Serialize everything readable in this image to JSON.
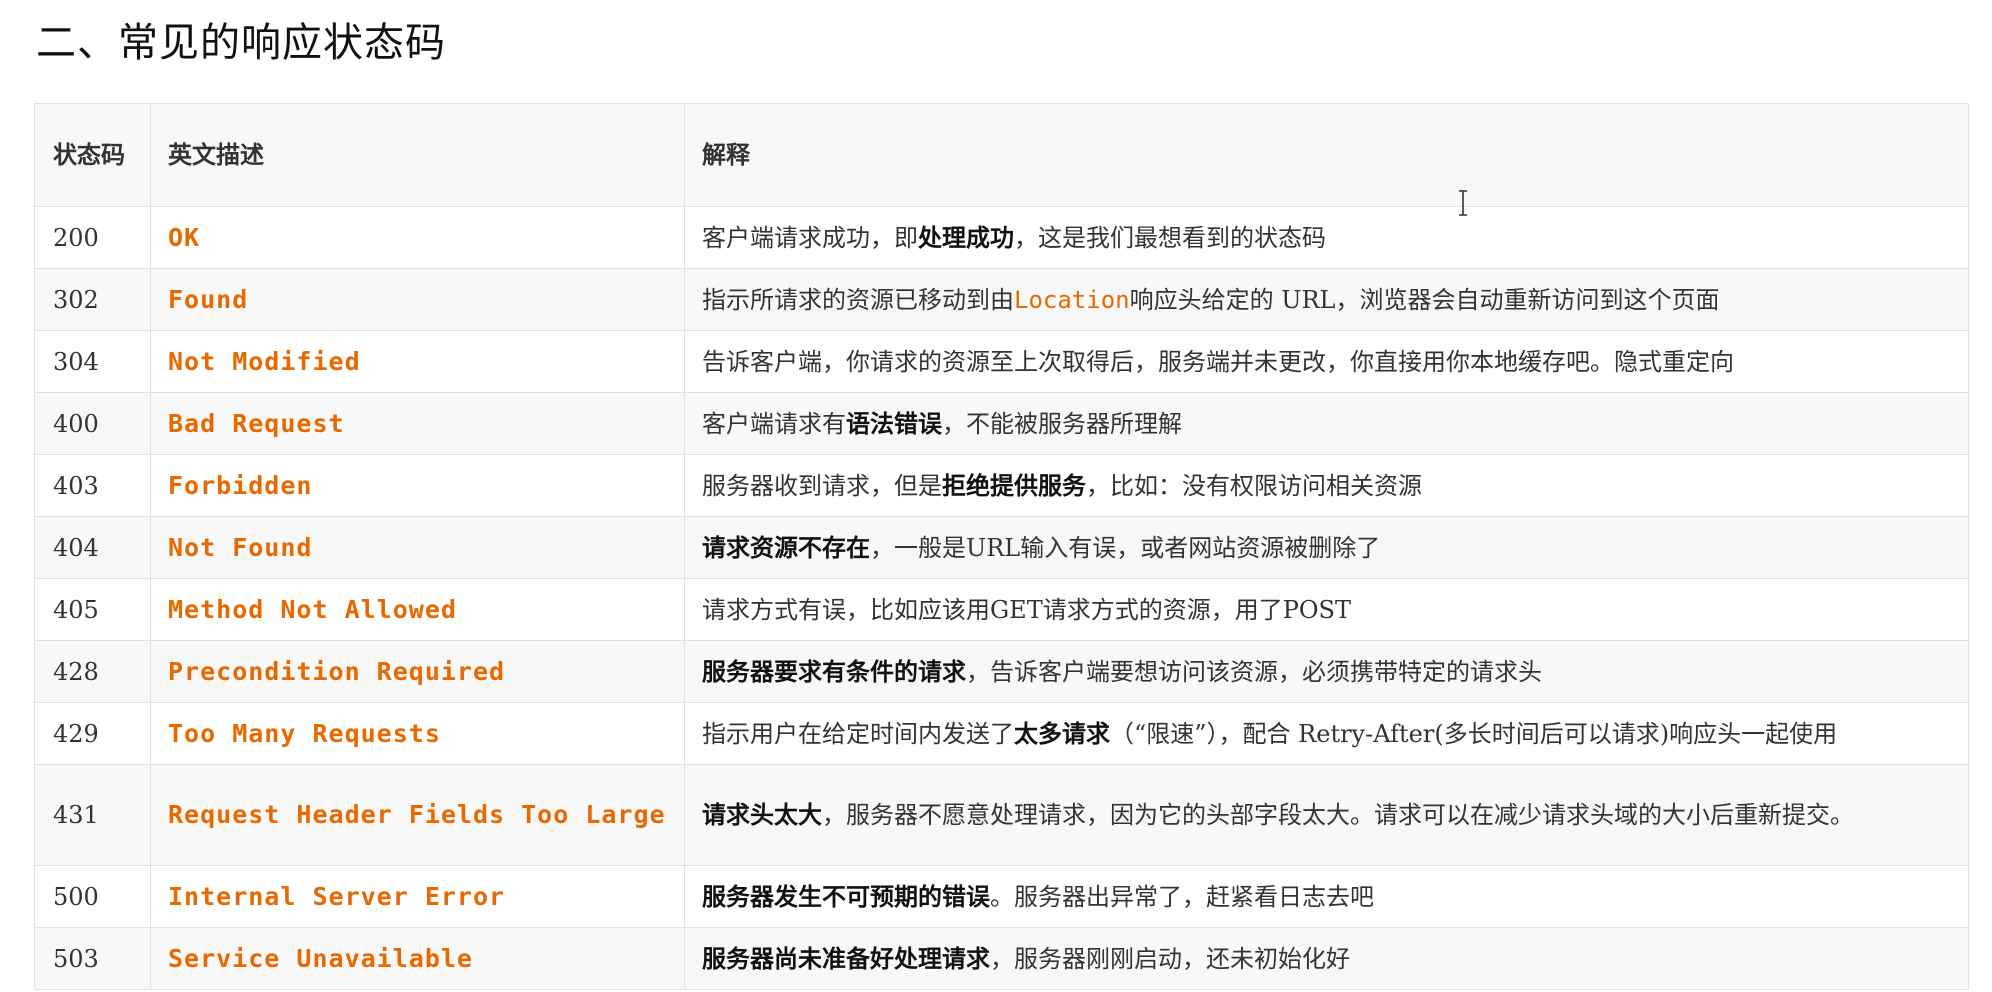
{
  "heading": "二、常见的响应状态码",
  "table": {
    "headers": [
      "状态码",
      "英文描述",
      "解释"
    ],
    "rows": [
      {
        "code": "200",
        "en": "OK",
        "desc": [
          [
            "客户端请求成功，即",
            ""
          ],
          [
            "处理成功",
            "b"
          ],
          [
            "，这是我们最想看到的状态码",
            ""
          ]
        ]
      },
      {
        "code": "302",
        "en": "Found",
        "desc": [
          [
            "指示所请求的资源已移动到由",
            ""
          ],
          [
            "Location",
            "m"
          ],
          [
            "响应头给定的 URL，浏览器会自动重新访问到这个页面",
            ""
          ]
        ]
      },
      {
        "code": "304",
        "en": "Not Modified",
        "desc": [
          [
            "告诉客户端，你请求的资源至上次取得后，服务端并未更改，你直接用你本地缓存吧。隐式重定向",
            ""
          ]
        ]
      },
      {
        "code": "400",
        "en": "Bad Request",
        "desc": [
          [
            "客户端请求有",
            ""
          ],
          [
            "语法错误",
            "b"
          ],
          [
            "，不能被服务器所理解",
            ""
          ]
        ]
      },
      {
        "code": "403",
        "en": "Forbidden",
        "desc": [
          [
            "服务器收到请求，但是",
            ""
          ],
          [
            "拒绝提供服务",
            "b"
          ],
          [
            "，比如：没有权限访问相关资源",
            ""
          ]
        ]
      },
      {
        "code": "404",
        "en": "Not Found",
        "desc": [
          [
            "请求资源不存在",
            "b"
          ],
          [
            "，一般是URL输入有误，或者网站资源被删除了",
            ""
          ]
        ]
      },
      {
        "code": "405",
        "en": "Method Not Allowed",
        "desc": [
          [
            "请求方式有误，比如应该用GET请求方式的资源，用了POST",
            ""
          ]
        ]
      },
      {
        "code": "428",
        "en": "Precondition Required",
        "desc": [
          [
            "服务器要求有条件的请求",
            "b"
          ],
          [
            "，告诉客户端要想访问该资源，必须携带特定的请求头",
            ""
          ]
        ]
      },
      {
        "code": "429",
        "en": "Too Many Requests",
        "desc": [
          [
            "指示用户在给定时间内发送了",
            ""
          ],
          [
            "太多请求",
            "b"
          ],
          [
            "（“限速”），配合 Retry-After(多长时间后可以请求)响应头一起使用",
            ""
          ]
        ]
      },
      {
        "code": "431",
        "en": "Request Header Fields Too Large",
        "desc": [
          [
            "请求头太大",
            "b"
          ],
          [
            "，服务器不愿意处理请求，因为它的头部字段太大。请求可以在减少请求头域的大小后重新提交。",
            ""
          ]
        ]
      },
      {
        "code": "500",
        "en": "Internal Server Error",
        "desc": [
          [
            "服务器发生不可预期的错误",
            "b"
          ],
          [
            "。服务器出异常了，赶紧看日志去吧",
            ""
          ]
        ]
      },
      {
        "code": "503",
        "en": "Service Unavailable",
        "desc": [
          [
            "服务器尚未准备好处理请求",
            "b"
          ],
          [
            "，服务器刚刚启动，还未初始化好",
            ""
          ]
        ]
      }
    ]
  },
  "colors": {
    "code_accent": "#e96900",
    "header_bg": "#f6f8fa",
    "border": "#dfe2e5"
  },
  "icons": {
    "cursor": "text-cursor-icon"
  }
}
